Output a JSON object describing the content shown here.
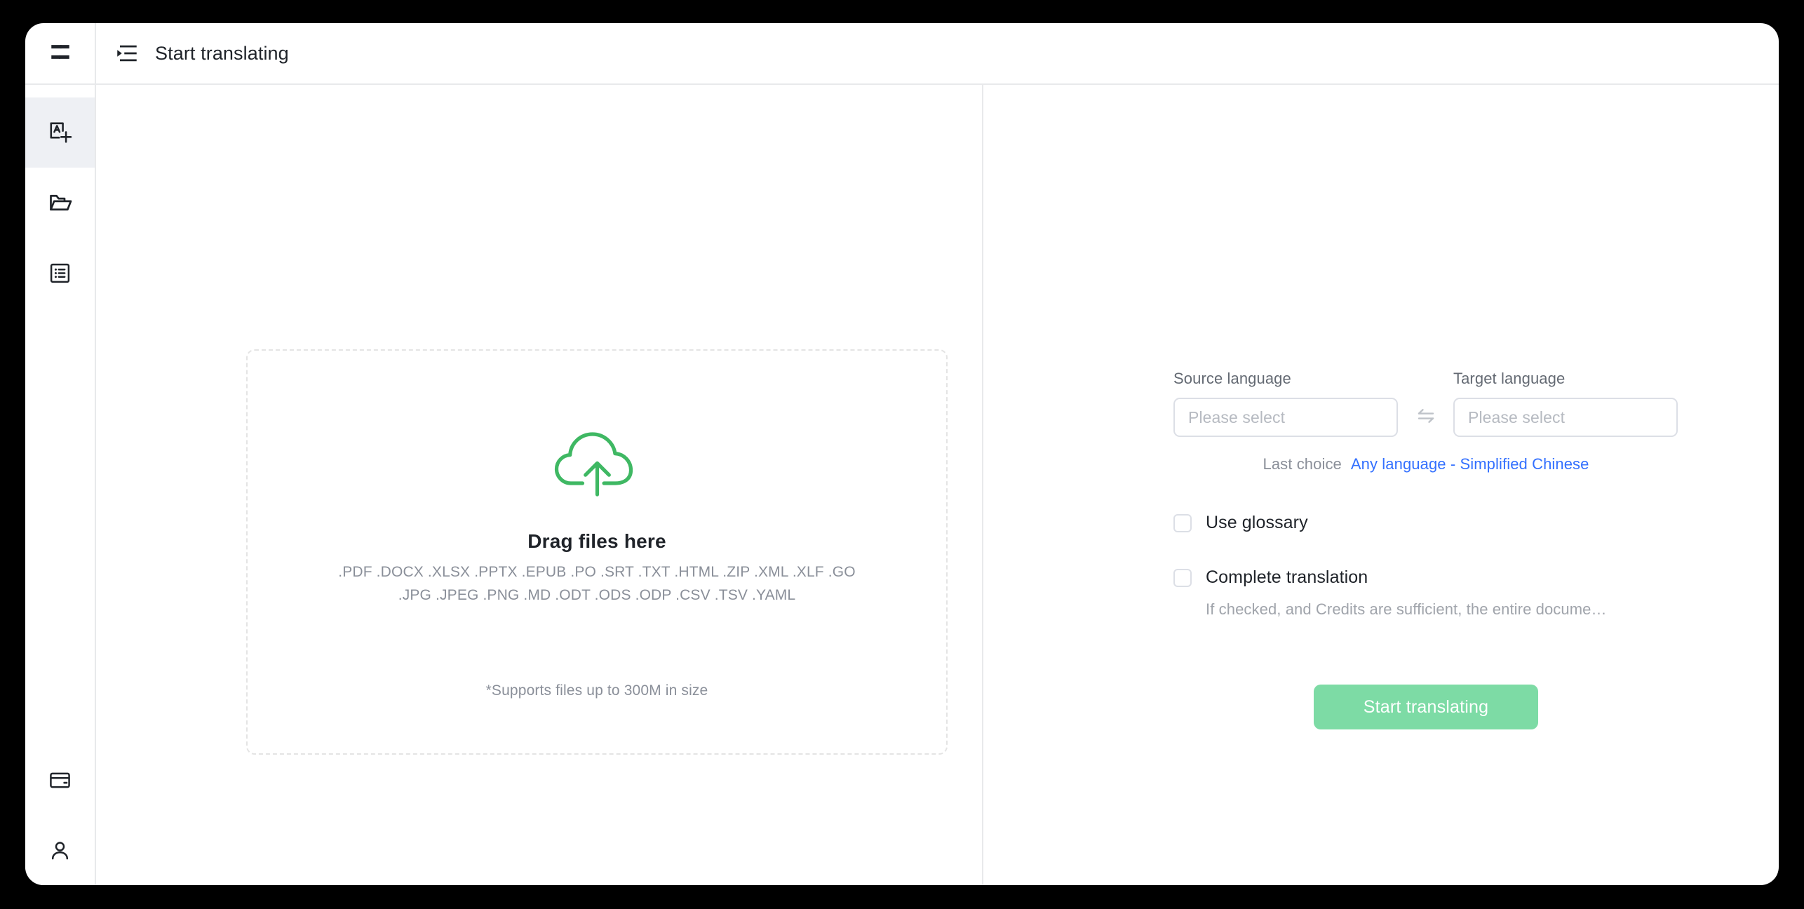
{
  "window": {
    "logo_icon": "swap-logo-icon"
  },
  "titlebar": {
    "collapse_icon": "indent-menu-icon",
    "title": "Start translating"
  },
  "sidebar": {
    "top_items": [
      {
        "icon": "translate-document-icon",
        "name": "sidebar-item-translate",
        "active": true
      },
      {
        "icon": "folder-open-icon",
        "name": "sidebar-item-files",
        "active": false
      },
      {
        "icon": "list-box-icon",
        "name": "sidebar-item-glossary",
        "active": false
      }
    ],
    "bottom_items": [
      {
        "icon": "credit-card-icon",
        "name": "sidebar-item-billing",
        "active": false
      },
      {
        "icon": "user-avatar-icon",
        "name": "sidebar-item-account",
        "active": false
      }
    ]
  },
  "upload": {
    "cloud_icon": "cloud-upload-icon",
    "drop_title": "Drag files here",
    "extensions_line1": ".PDF .DOCX .XLSX .PPTX .EPUB .PO .SRT .TXT .HTML .ZIP .XML .XLF .GO",
    "extensions_line2": ".JPG .JPEG .PNG .MD .ODT .ODS .ODP .CSV .TSV .YAML",
    "size_note": "*Supports files up to 300M in size"
  },
  "settings": {
    "source_label": "Source language",
    "source_value": "Please select",
    "target_label": "Target language",
    "target_value": "Please select",
    "swap_icon": "swap-horizontal-icon",
    "last_choice_label": "Last choice",
    "last_choice_value": "Any language - Simplified Chinese",
    "use_glossary_label": "Use glossary",
    "complete_translation_label": "Complete translation",
    "complete_translation_hint": "If checked, and Credits are sufficient, the entire docume…",
    "start_button": "Start translating"
  },
  "colors": {
    "accent_green": "#7ddba5",
    "cloud_green": "#3fb863",
    "link_blue": "#3370ff",
    "active_nav_bg": "#eef0f4",
    "border": "#e8e9eb",
    "dashed_border": "#e4e4e4"
  }
}
